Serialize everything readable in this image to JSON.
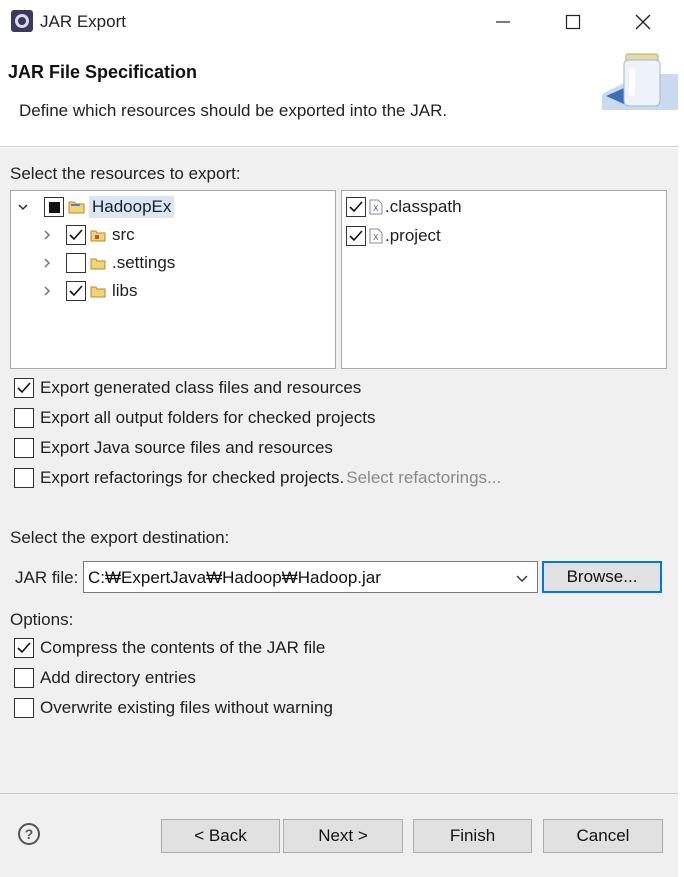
{
  "window": {
    "title": "JAR Export",
    "minimize": "—",
    "maximize": "☐",
    "close": "✕"
  },
  "banner": {
    "title": "JAR File Specification",
    "description": "Define which resources should be exported into the JAR."
  },
  "resources": {
    "label": "Select the resources to export:",
    "tree": [
      {
        "label": "HadoopEx",
        "state": "partial",
        "expanded": true,
        "icon": "project-folder-icon"
      },
      {
        "label": "src",
        "state": "checked",
        "icon": "package-folder-icon"
      },
      {
        "label": ".settings",
        "state": "unchecked",
        "icon": "folder-icon"
      },
      {
        "label": "libs",
        "state": "checked",
        "icon": "folder-icon"
      }
    ],
    "files": [
      {
        "label": ".classpath",
        "state": "checked",
        "icon": "xml-file-icon"
      },
      {
        "label": ".project",
        "state": "checked",
        "icon": "xml-file-icon"
      }
    ]
  },
  "export_options": {
    "generated_class": {
      "label": "Export generated class files and resources",
      "checked": true
    },
    "output_folders": {
      "label": "Export all output folders for checked projects",
      "checked": false
    },
    "java_source": {
      "label": "Export Java source files and resources",
      "checked": false
    },
    "refactorings": {
      "label": "Export refactorings for checked projects.",
      "checked": false
    },
    "select_refactorings": "Select refactorings..."
  },
  "destination": {
    "label": "Select the export destination:",
    "jar_file_label": "JAR file:",
    "jar_file_value": "C:₩ExpertJava₩Hadoop₩Hadoop.jar",
    "browse": "Browse..."
  },
  "options": {
    "label": "Options:",
    "compress": {
      "label": "Compress the contents of the JAR file",
      "checked": true
    },
    "directory_entries": {
      "label": "Add directory entries",
      "checked": false
    },
    "overwrite": {
      "label": "Overwrite existing files without warning",
      "checked": false
    }
  },
  "footer": {
    "help": "?",
    "back": "< Back",
    "next": "Next >",
    "finish": "Finish",
    "cancel": "Cancel"
  },
  "colors": {
    "accent": "#0078d7",
    "dialog_bg": "#f0f0f0",
    "disabled_text": "#8a8a8a"
  }
}
